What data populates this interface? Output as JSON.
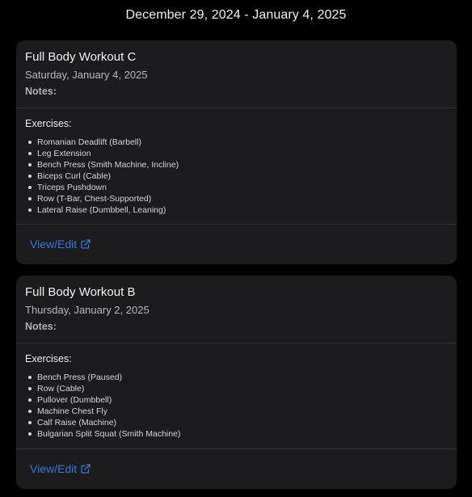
{
  "week": {
    "range": "December 29, 2024 - January 4, 2025"
  },
  "workouts": [
    {
      "title": "Full Body Workout C",
      "date": "Saturday, January 4, 2025",
      "notes_label": "Notes:",
      "exercises_label": "Exercises:",
      "exercises": [
        "Romanian Deadlift (Barbell)",
        "Leg Extension",
        "Bench Press (Smith Machine, Incline)",
        "Biceps Curl (Cable)",
        "Triceps Pushdown",
        "Row (T-Bar, Chest-Supported)",
        "Lateral Raise (Dumbbell, Leaning)"
      ],
      "link_label": "View/Edit",
      "link_icon": "external-link-icon"
    },
    {
      "title": "Full Body Workout B",
      "date": "Thursday, January 2, 2025",
      "notes_label": "Notes:",
      "exercises_label": "Exercises:",
      "exercises": [
        "Bench Press (Paused)",
        "Row (Cable)",
        "Pullover (Dumbbell)",
        "Machine Chest Fly",
        "Calf Raise (Machine)",
        "Bulgarian Split Squat (Smith Machine)"
      ],
      "link_label": "View/Edit",
      "link_icon": "external-link-icon"
    }
  ],
  "colors": {
    "background": "#000000",
    "card": "#1c1c1e",
    "divider": "#323236",
    "link": "#2f7bd9"
  }
}
